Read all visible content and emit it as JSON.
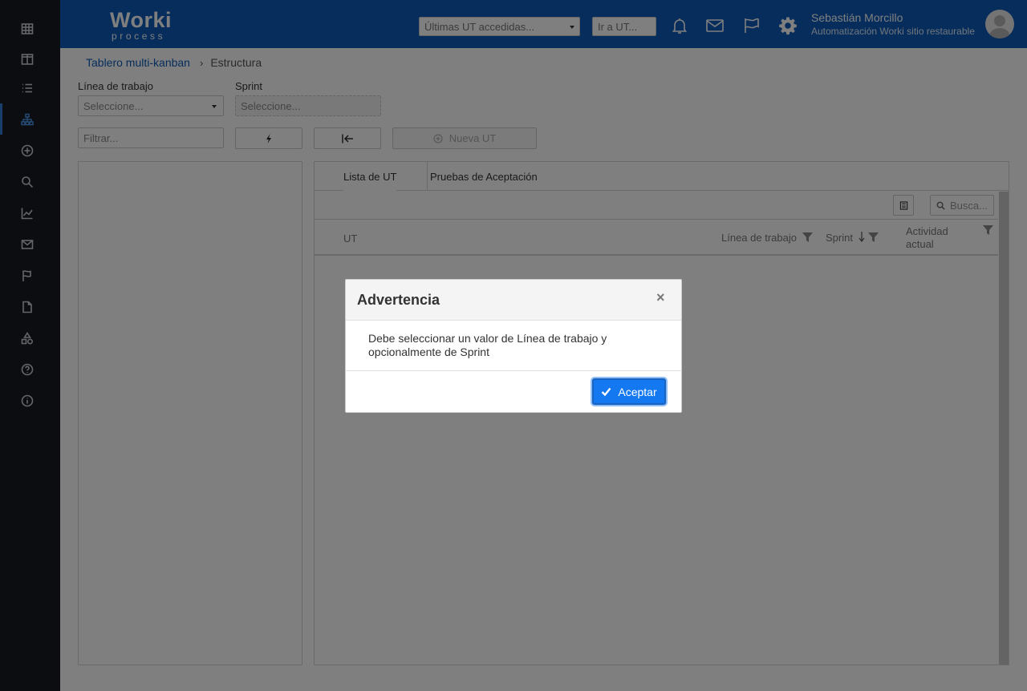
{
  "header": {
    "logo_main": "Worki",
    "logo_sub": "process",
    "recent_select_placeholder": "Últimas UT accedidas...",
    "goto_placeholder": "Ir a UT...",
    "user_name": "Sebastián Morcillo",
    "user_subtitle": "Automatización Worki sitio restaurable"
  },
  "sidebar": {
    "items": [
      {
        "icon": "table-icon"
      },
      {
        "icon": "columns-icon"
      },
      {
        "icon": "list-icon"
      },
      {
        "icon": "hierarchy-icon",
        "active": true
      },
      {
        "icon": "plus-circle-icon"
      },
      {
        "icon": "search-icon"
      },
      {
        "icon": "chart-line-icon"
      },
      {
        "icon": "mail-icon"
      },
      {
        "icon": "flag-icon"
      },
      {
        "icon": "file-icon"
      },
      {
        "icon": "shapes-icon"
      },
      {
        "icon": "help-icon"
      },
      {
        "icon": "info-icon"
      }
    ]
  },
  "breadcrumb": {
    "parent": "Tablero multi-kanban",
    "separator": "›",
    "current": "Estructura"
  },
  "filters": {
    "linea_label": "Línea de trabajo",
    "linea_placeholder": "Seleccione...",
    "sprint_label": "Sprint",
    "sprint_placeholder": "Seleccione...",
    "filter_placeholder": "Filtrar...",
    "new_ut_label": "Nueva UT"
  },
  "tabs": {
    "list_label": "Lista de UT",
    "acceptance_label": "Pruebas de Aceptación"
  },
  "grid": {
    "search_placeholder": "Busca...",
    "columns": {
      "ut": "UT",
      "linea": "Línea de trabajo",
      "sprint": "Sprint",
      "actividad_1": "Actividad",
      "actividad_2": "actual"
    }
  },
  "modal": {
    "title": "Advertencia",
    "close": "×",
    "message_line1": "Debe seleccionar un valor de Línea de trabajo y",
    "message_line2": "opcionalmente de Sprint",
    "accept_label": "Aceptar"
  },
  "colors": {
    "header_bg": "#0d5bb8",
    "sidebar_bg": "#161a20",
    "primary_button": "#1479f1"
  }
}
